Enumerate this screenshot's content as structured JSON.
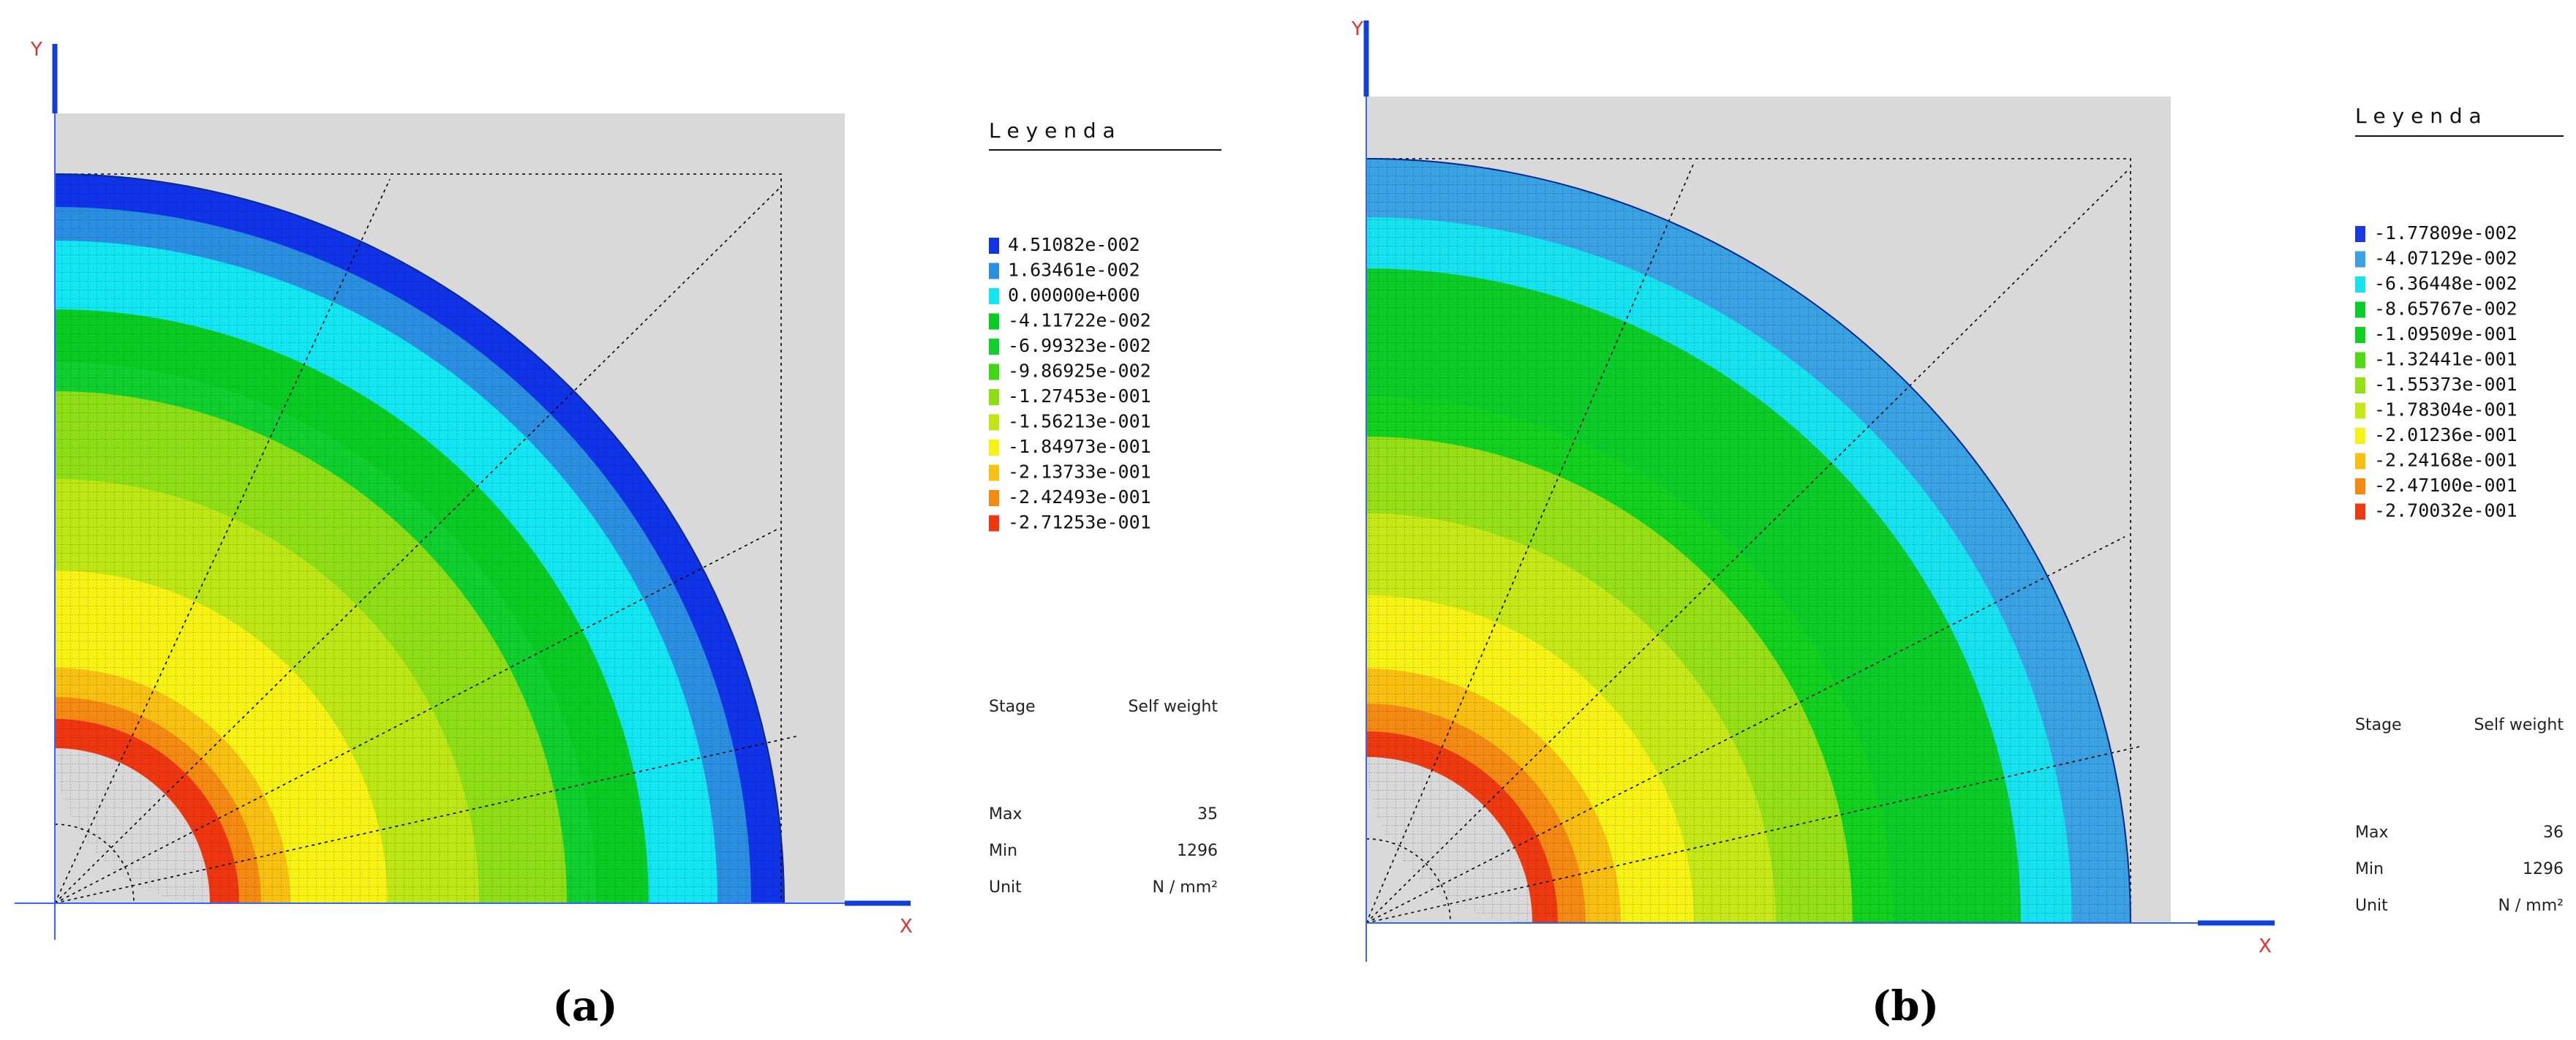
{
  "panels": [
    {
      "caption": "(a)",
      "axis_x_label": "X",
      "axis_y_label": "Y",
      "legend_title": "L e y e n d a",
      "legend": [
        {
          "value": "4.51082e-002",
          "color": "#1033e8"
        },
        {
          "value": "1.63461e-002",
          "color": "#2a8fe0"
        },
        {
          "value": "0.00000e+000",
          "color": "#12e6f2"
        },
        {
          "value": "-4.11722e-002",
          "color": "#08cc24"
        },
        {
          "value": "-6.99323e-002",
          "color": "#10d030"
        },
        {
          "value": "-9.86925e-002",
          "color": "#3ed814"
        },
        {
          "value": "-1.27453e-001",
          "color": "#8ede16"
        },
        {
          "value": "-1.56213e-001",
          "color": "#bee614"
        },
        {
          "value": "-1.84973e-001",
          "color": "#f6f214"
        },
        {
          "value": "-2.13733e-001",
          "color": "#f8c010"
        },
        {
          "value": "-2.42493e-001",
          "color": "#f48a12"
        },
        {
          "value": "-2.71253e-001",
          "color": "#ee3610"
        }
      ],
      "info": [
        {
          "label": "Stage",
          "value": "Self weight"
        },
        {
          "label": "Max",
          "value": "35"
        },
        {
          "label": "Min",
          "value": "1296"
        },
        {
          "label": "Unit",
          "value": "N / mm²"
        }
      ]
    },
    {
      "caption": "(b)",
      "axis_x_label": "X",
      "axis_y_label": "Y",
      "legend_title": "L e y e n d a",
      "legend": [
        {
          "value": "-1.77809e-002",
          "color": "#1a3ae0"
        },
        {
          "value": "-4.07129e-002",
          "color": "#3aa2e2"
        },
        {
          "value": "-6.36448e-002",
          "color": "#16e2f0"
        },
        {
          "value": "-8.65767e-002",
          "color": "#0ccc2a"
        },
        {
          "value": "-1.09509e-001",
          "color": "#12d01e"
        },
        {
          "value": "-1.32441e-001",
          "color": "#50d814"
        },
        {
          "value": "-1.55373e-001",
          "color": "#96de16"
        },
        {
          "value": "-1.78304e-001",
          "color": "#c6e816"
        },
        {
          "value": "-2.01236e-001",
          "color": "#f6f214"
        },
        {
          "value": "-2.24168e-001",
          "color": "#f8be10"
        },
        {
          "value": "-2.47100e-001",
          "color": "#f48a12"
        },
        {
          "value": "-2.70032e-001",
          "color": "#ee3a10"
        }
      ],
      "info": [
        {
          "label": "Stage",
          "value": "Self weight"
        },
        {
          "label": "Max",
          "value": "36"
        },
        {
          "label": "Min",
          "value": "1296"
        },
        {
          "label": "Unit",
          "value": "N / mm²"
        }
      ]
    }
  ]
}
